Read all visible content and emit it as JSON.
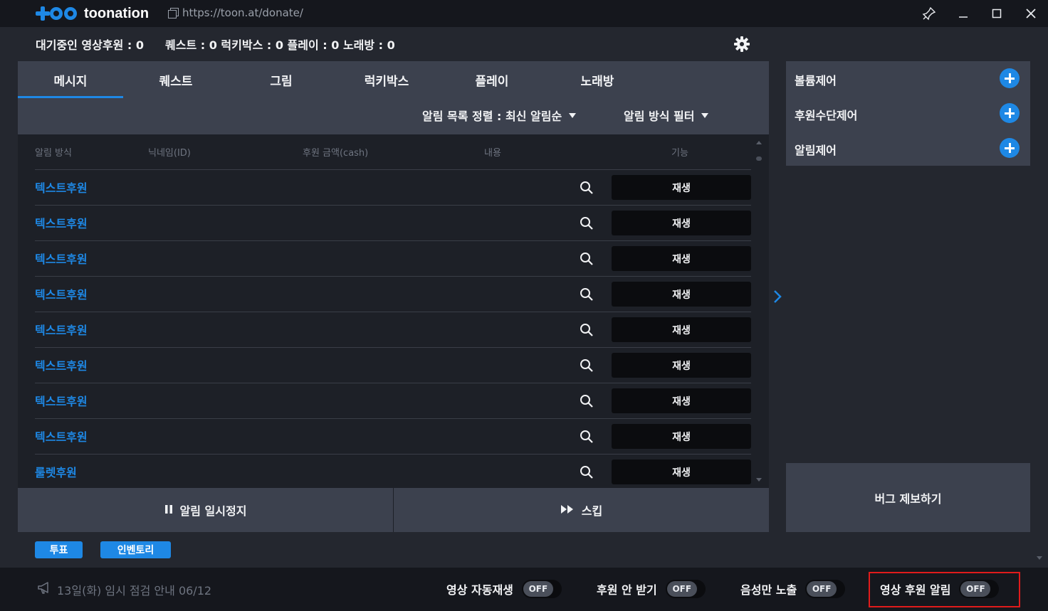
{
  "window": {
    "brand": "toonation",
    "url": "https://toon.at/donate/"
  },
  "status": {
    "waiting_video": "대기중인 영상후원 : 0",
    "counts": "퀘스트 : 0 럭키박스 : 0 플레이 : 0 노래방 : 0"
  },
  "tabs": [
    {
      "label": "메시지",
      "active": true
    },
    {
      "label": "퀘스트",
      "active": false
    },
    {
      "label": "그림",
      "active": false
    },
    {
      "label": "럭키박스",
      "active": false
    },
    {
      "label": "플레이",
      "active": false
    },
    {
      "label": "노래방",
      "active": false
    }
  ],
  "filters": {
    "sort_label": "알림 목록 정렬 : 최신 알림순",
    "method_filter_label": "알림 방식 필터"
  },
  "table": {
    "columns": [
      "알림 방식",
      "닉네임(ID)",
      "후원 금액(cash)",
      "내용",
      "기능"
    ],
    "rows": [
      {
        "type": "텍스트후원",
        "action": "재생"
      },
      {
        "type": "텍스트후원",
        "action": "재생"
      },
      {
        "type": "텍스트후원",
        "action": "재생"
      },
      {
        "type": "텍스트후원",
        "action": "재생"
      },
      {
        "type": "텍스트후원",
        "action": "재생"
      },
      {
        "type": "텍스트후원",
        "action": "재생"
      },
      {
        "type": "텍스트후원",
        "action": "재생"
      },
      {
        "type": "텍스트후원",
        "action": "재생"
      },
      {
        "type": "룰렛후원",
        "action": "재생"
      }
    ]
  },
  "controls": {
    "pause": "알림 일시정지",
    "skip": "스킵"
  },
  "side_panel": {
    "items": [
      "볼륨제어",
      "후원수단제어",
      "알림제어"
    ],
    "bug_report": "버그 제보하기"
  },
  "chips": [
    "투표",
    "인벤토리"
  ],
  "footer": {
    "notice": "13일(화) 임시 점검 안내 06/12",
    "toggles": [
      {
        "label": "영상 자동재생",
        "state": "OFF"
      },
      {
        "label": "후원 안 받기",
        "state": "OFF"
      },
      {
        "label": "음성만 노출",
        "state": "OFF"
      },
      {
        "label": "영상 후원 알림",
        "state": "OFF"
      }
    ]
  },
  "colors": {
    "accent": "#1e88e5",
    "highlight": "#e01b1b"
  }
}
